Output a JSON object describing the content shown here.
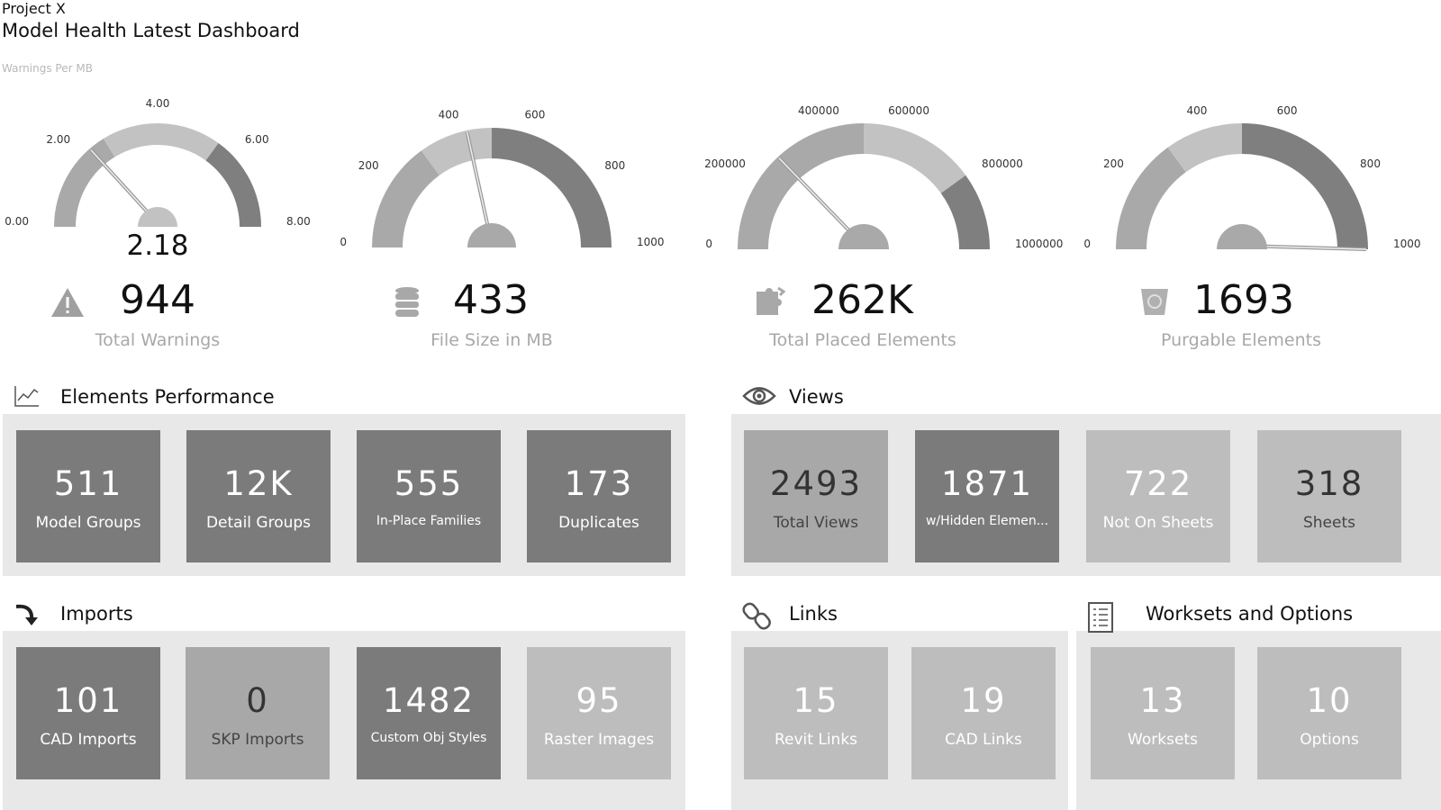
{
  "header": {
    "project": "Project X",
    "title": "Model Health Latest Dashboard",
    "subtitle": "Warnings Per MB"
  },
  "colors": {
    "band_low": "#a9a9a9",
    "band_mid": "#c2c2c2",
    "band_high": "#7f7f7f",
    "tile_dark": "#7b7b7b",
    "tile_mid": "#a8a8a8",
    "tile_light": "#bdbdbd",
    "panel_bg": "#e8e8e8"
  },
  "gauges": [
    {
      "min": 0,
      "max": 8,
      "value": 2.18,
      "value_label": "2.18",
      "bands": [
        2.6,
        5.6
      ],
      "ticks": [
        "0.00",
        "2.00",
        "4.00",
        "6.00",
        "8.00"
      ]
    },
    {
      "min": 0,
      "max": 1000,
      "value": 433,
      "bands": [
        300,
        500
      ],
      "ticks": [
        "0",
        "200",
        "400",
        "600",
        "800",
        "1000"
      ]
    },
    {
      "min": 0,
      "max": 1000000,
      "value": 262000,
      "bands": [
        500000,
        800000
      ],
      "ticks": [
        "0",
        "200000",
        "400000",
        "600000",
        "800000",
        "1000000"
      ]
    },
    {
      "min": 0,
      "max": 1000,
      "value": 1693,
      "bands": [
        300,
        500
      ],
      "ticks": [
        "0",
        "200",
        "400",
        "600",
        "800",
        "1000"
      ]
    }
  ],
  "kpis": [
    {
      "icon": "warning-icon",
      "value": "944",
      "label": "Total Warnings"
    },
    {
      "icon": "database-icon",
      "value": "433",
      "label": "File Size in MB"
    },
    {
      "icon": "puzzle-icon",
      "value": "262K",
      "label": "Total Placed Elements"
    },
    {
      "icon": "recycle-bin-icon",
      "value": "1693",
      "label": "Purgable Elements"
    }
  ],
  "sections": {
    "elements_performance": {
      "title": "Elements Performance",
      "icon": "line-chart-icon",
      "tiles": [
        {
          "value": "511",
          "label": "Model Groups",
          "shade": "dark"
        },
        {
          "value": "12K",
          "label": "Detail Groups",
          "shade": "dark"
        },
        {
          "value": "555",
          "label": "In-Place Families",
          "shade": "dark"
        },
        {
          "value": "173",
          "label": "Duplicates",
          "shade": "dark"
        }
      ]
    },
    "views": {
      "title": "Views",
      "icon": "eye-icon",
      "tiles": [
        {
          "value": "2493",
          "label": "Total Views",
          "shade": "mid"
        },
        {
          "value": "1871",
          "label": "w/Hidden Elemen...",
          "shade": "dark"
        },
        {
          "value": "722",
          "label": "Not On Sheets",
          "shade": "light"
        },
        {
          "value": "318",
          "label": "Sheets",
          "shade": "light-darktext"
        }
      ]
    },
    "imports": {
      "title": "Imports",
      "icon": "curved-arrow-icon",
      "tiles": [
        {
          "value": "101",
          "label": "CAD Imports",
          "shade": "dark"
        },
        {
          "value": "0",
          "label": "SKP Imports",
          "shade": "mid"
        },
        {
          "value": "1482",
          "label": "Custom Obj Styles",
          "shade": "dark"
        },
        {
          "value": "95",
          "label": "Raster Images",
          "shade": "light"
        }
      ]
    },
    "links": {
      "title": "Links",
      "icon": "link-icon",
      "tiles": [
        {
          "value": "15",
          "label": "Revit Links",
          "shade": "light"
        },
        {
          "value": "19",
          "label": "CAD Links",
          "shade": "light"
        }
      ]
    },
    "worksets": {
      "title": "Worksets and Options",
      "icon": "checklist-icon",
      "tiles": [
        {
          "value": "13",
          "label": "Worksets",
          "shade": "light"
        },
        {
          "value": "10",
          "label": "Options",
          "shade": "light"
        }
      ]
    }
  }
}
